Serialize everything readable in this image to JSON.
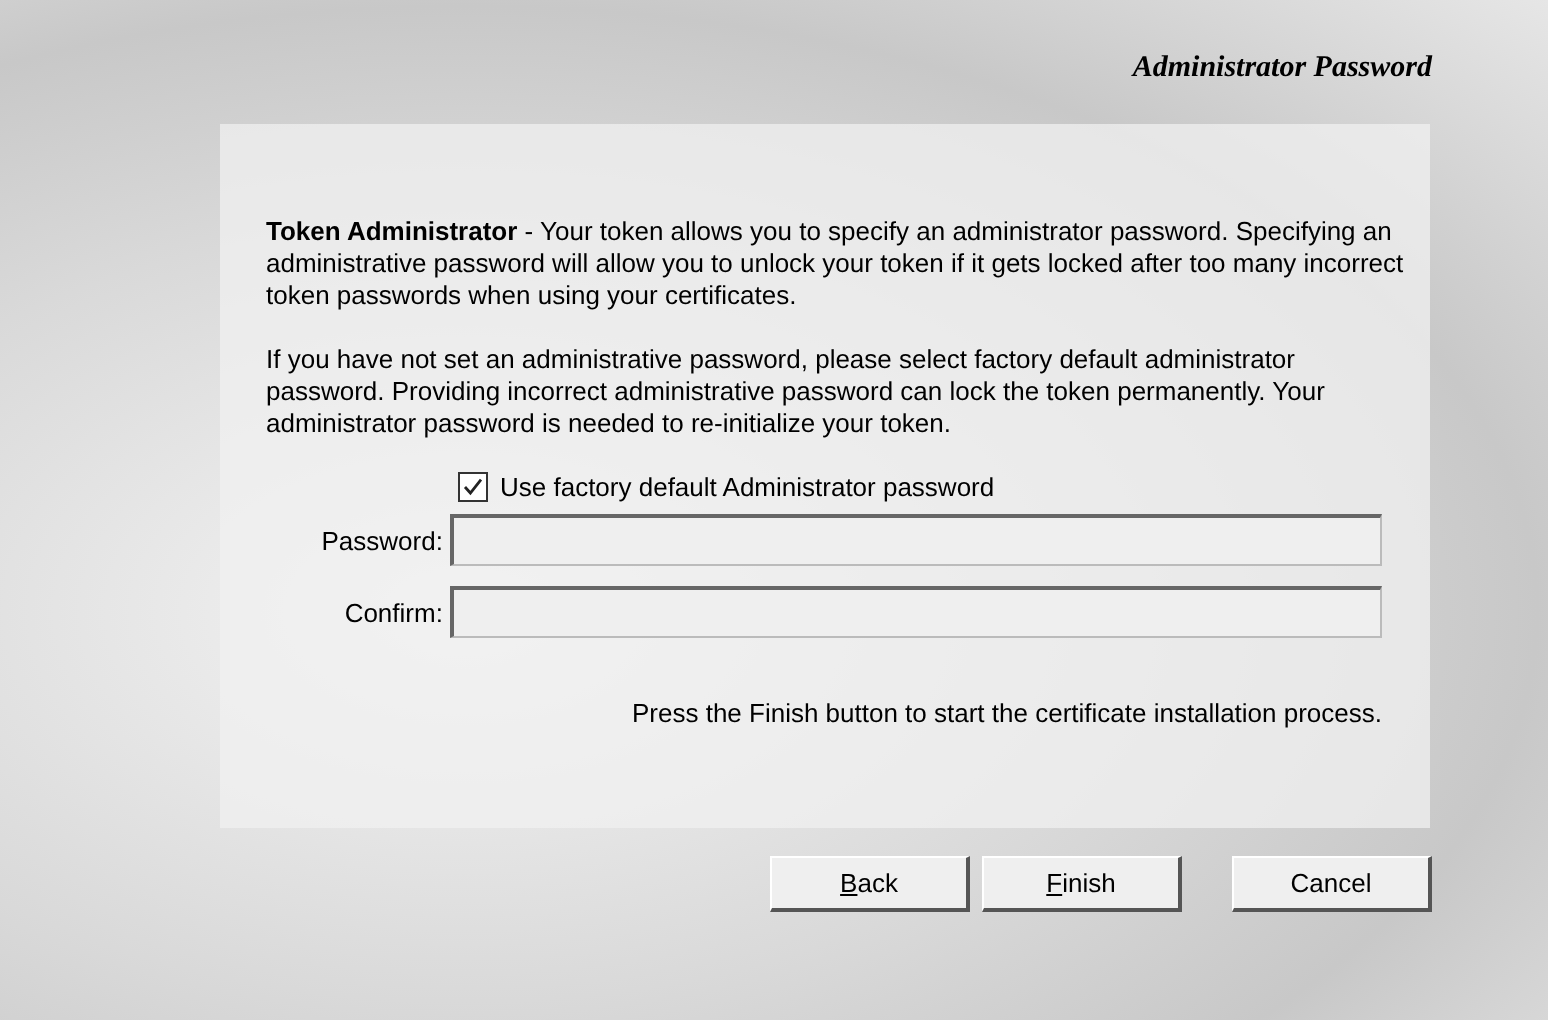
{
  "header": {
    "title": "Administrator Password"
  },
  "paragraphs": [
    "**Token Administrator** - Your token allows you to specify an administrator password. Specifying an administrative password will allow you to unlock your token if it gets locked after too many incorrect token passwords when using your certificates.",
    "If you have not set an administrative password, please select factory default administrator password.  Providing incorrect administrative password can lock the token permanently.  Your administrator password is needed to re-initialize your token."
  ],
  "checkbox": {
    "label": "Use factory default Administrator password",
    "checked": true
  },
  "fields": [
    {
      "label": "Password:",
      "disabled": true
    },
    {
      "label": "Confirm:",
      "disabled": true
    }
  ],
  "hint": "Press the Finish button to start the certificate installation process.",
  "buttons": [
    {
      "label": "Back",
      "accelerator": true
    },
    {
      "label": "Finish",
      "accelerator": true
    },
    {
      "label": "Cancel",
      "accelerator": false
    }
  ]
}
